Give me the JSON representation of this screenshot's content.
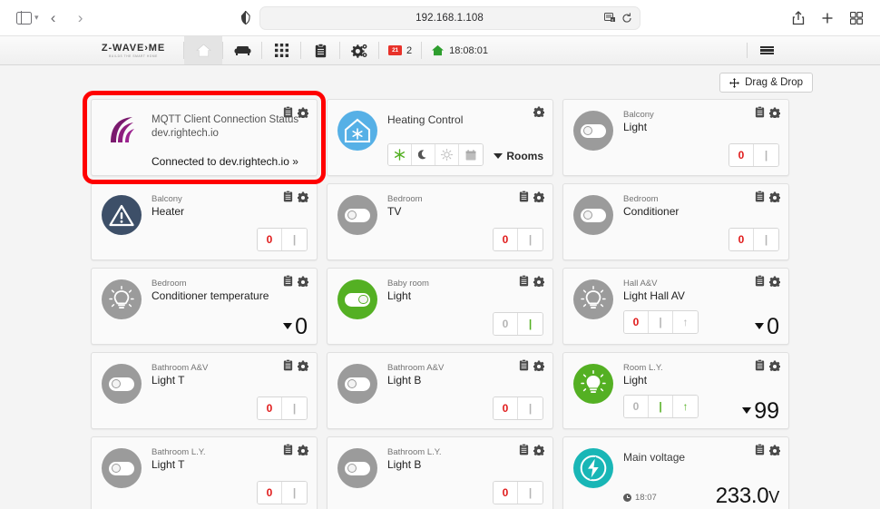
{
  "browser": {
    "url": "192.168.1.108",
    "icons": {
      "sidebar": "sidebar-toggle-icon",
      "back": "back-arrow-icon",
      "forward": "forward-arrow-icon",
      "shield": "shield-privacy-icon",
      "reader": "reader-view-icon",
      "reload": "reload-icon",
      "share": "share-icon",
      "newtab": "plus-new-tab-icon",
      "tabs": "show-all-tabs-icon"
    }
  },
  "appnav": {
    "brand_name": "Z-WAVE›ME",
    "brand_tagline": "BUILDS THE SMART HOME",
    "items": [
      {
        "name": "home",
        "icon": "home-icon",
        "active": true
      },
      {
        "name": "furniture",
        "icon": "sofa-icon",
        "active": false
      },
      {
        "name": "apps",
        "icon": "grid-apps-icon",
        "active": false
      },
      {
        "name": "events",
        "icon": "clipboard-icon",
        "active": false
      },
      {
        "name": "settings",
        "icon": "gears-icon",
        "active": false
      }
    ],
    "notification_badge_label": "21",
    "notification_count": "2",
    "time": "18:08:01",
    "time_icon": "green-house-icon",
    "menu_icon": "hamburger-menu-icon"
  },
  "toolbar": {
    "drag_drop_label": "Drag & Drop",
    "drag_drop_icon": "move-arrows-icon"
  },
  "cards": [
    {
      "id": "mqtt-client-connection-status",
      "icon": "mqtt-signal-arcs-icon",
      "icon_style": "plain",
      "highlighted": true,
      "title": "MQTT Client Connection Status dev.rightech.io",
      "status": "Connected to dev.rightech.io »",
      "tools": [
        "clipboard-icon",
        "gear-icon"
      ]
    },
    {
      "id": "heating-control",
      "icon": "house-snowflake-icon",
      "icon_style": "blue-house",
      "title": "Heating Control",
      "modes": [
        {
          "name": "frost-protection",
          "icon": "✳",
          "active": true
        },
        {
          "name": "night-mode",
          "icon": "☾",
          "active": false
        },
        {
          "name": "day-mode",
          "icon": "☀",
          "active": false
        },
        {
          "name": "schedule-mode",
          "icon": "Ὄ5",
          "active": false
        }
      ],
      "rooms_label": "Rooms",
      "tools": [
        "gear-icon"
      ]
    },
    {
      "id": "balcony-light",
      "icon": "toggle-switch-icon",
      "icon_style": "grey",
      "room": "Balcony",
      "title": "Light",
      "buttons": [
        {
          "label": "0",
          "color": "red"
        },
        {
          "label": "|",
          "color": "grey"
        }
      ],
      "tools": [
        "clipboard-icon",
        "gear-icon"
      ]
    },
    {
      "id": "balcony-heater",
      "icon": "warning-triangle-icon",
      "icon_style": "darkblue",
      "room": "Balcony",
      "title": "Heater",
      "buttons": [
        {
          "label": "0",
          "color": "red"
        },
        {
          "label": "|",
          "color": "grey"
        }
      ],
      "tools": [
        "clipboard-icon",
        "gear-icon"
      ]
    },
    {
      "id": "bedroom-tv",
      "icon": "toggle-switch-icon",
      "icon_style": "grey",
      "room": "Bedroom",
      "title": "TV",
      "buttons": [
        {
          "label": "0",
          "color": "red"
        },
        {
          "label": "|",
          "color": "grey"
        }
      ],
      "tools": [
        "clipboard-icon",
        "gear-icon"
      ]
    },
    {
      "id": "bedroom-conditioner",
      "icon": "toggle-switch-icon",
      "icon_style": "grey",
      "room": "Bedroom",
      "title": "Conditioner",
      "buttons": [
        {
          "label": "0",
          "color": "red"
        },
        {
          "label": "|",
          "color": "grey"
        }
      ],
      "tools": [
        "clipboard-icon",
        "gear-icon"
      ]
    },
    {
      "id": "bedroom-conditioner-temperature",
      "icon": "light-bulb-icon",
      "icon_style": "grey",
      "room": "Bedroom",
      "title": "Conditioner temperature",
      "value": "0",
      "tools": [
        "clipboard-icon",
        "gear-icon"
      ]
    },
    {
      "id": "baby-room-light",
      "icon": "toggle-switch-icon",
      "icon_style": "green",
      "toggle_on": true,
      "room": "Baby room",
      "title": "Light",
      "buttons": [
        {
          "label": "0",
          "color": "grey"
        },
        {
          "label": "|",
          "color": "green"
        }
      ],
      "tools": [
        "clipboard-icon",
        "gear-icon"
      ]
    },
    {
      "id": "hall-av-light-hall-av",
      "icon": "light-bulb-icon",
      "icon_style": "grey",
      "room": "Hall A&V",
      "title": "Light Hall AV",
      "buttons": [
        {
          "label": "0",
          "color": "red"
        },
        {
          "label": "|",
          "color": "grey"
        },
        {
          "label": "↑",
          "color": "grey"
        }
      ],
      "value": "0",
      "tools": [
        "clipboard-icon",
        "gear-icon"
      ]
    },
    {
      "id": "bathroom-av-light-t",
      "icon": "toggle-switch-icon",
      "icon_style": "grey",
      "room": "Bathroom A&V",
      "title": "Light T",
      "buttons": [
        {
          "label": "0",
          "color": "red"
        },
        {
          "label": "|",
          "color": "grey"
        }
      ],
      "tools": [
        "clipboard-icon",
        "gear-icon"
      ]
    },
    {
      "id": "bathroom-av-light-b",
      "icon": "toggle-switch-icon",
      "icon_style": "grey",
      "room": "Bathroom A&V",
      "title": "Light B",
      "buttons": [
        {
          "label": "0",
          "color": "red"
        },
        {
          "label": "|",
          "color": "grey"
        }
      ],
      "tools": [
        "clipboard-icon",
        "gear-icon"
      ]
    },
    {
      "id": "room-ly-light",
      "icon": "light-bulb-icon",
      "icon_style": "green",
      "room": "Room L.Y.",
      "title": "Light",
      "buttons": [
        {
          "label": "0",
          "color": "grey"
        },
        {
          "label": "|",
          "color": "green"
        },
        {
          "label": "↑",
          "color": "green"
        }
      ],
      "value": "99",
      "tools": [
        "clipboard-icon",
        "gear-icon"
      ]
    },
    {
      "id": "bathroom-ly-light-t",
      "icon": "toggle-switch-icon",
      "icon_style": "grey",
      "room": "Bathroom L.Y.",
      "title": "Light T",
      "buttons": [
        {
          "label": "0",
          "color": "red"
        },
        {
          "label": "|",
          "color": "grey"
        }
      ],
      "tools": [
        "clipboard-icon",
        "gear-icon"
      ]
    },
    {
      "id": "bathroom-ly-light-b",
      "icon": "toggle-switch-icon",
      "icon_style": "grey",
      "room": "Bathroom L.Y.",
      "title": "Light B",
      "buttons": [
        {
          "label": "0",
          "color": "red"
        },
        {
          "label": "|",
          "color": "grey"
        }
      ],
      "tools": [
        "clipboard-icon",
        "gear-icon"
      ]
    },
    {
      "id": "main-voltage",
      "icon": "lightning-bolt-icon",
      "icon_style": "teal",
      "title": "Main voltage",
      "timestamp": "18:07",
      "value": "233.0",
      "unit": "V",
      "tools": [
        "clipboard-icon",
        "gear-icon"
      ]
    }
  ],
  "colors": {
    "accent_green": "#54b023",
    "accent_red": "#e01b1b",
    "accent_teal": "#19b6b6",
    "accent_blue": "#56b0e6",
    "accent_purple": "#8e1e7e",
    "highlight_border": "#ff0000",
    "page_background": "#f4f4f4"
  }
}
